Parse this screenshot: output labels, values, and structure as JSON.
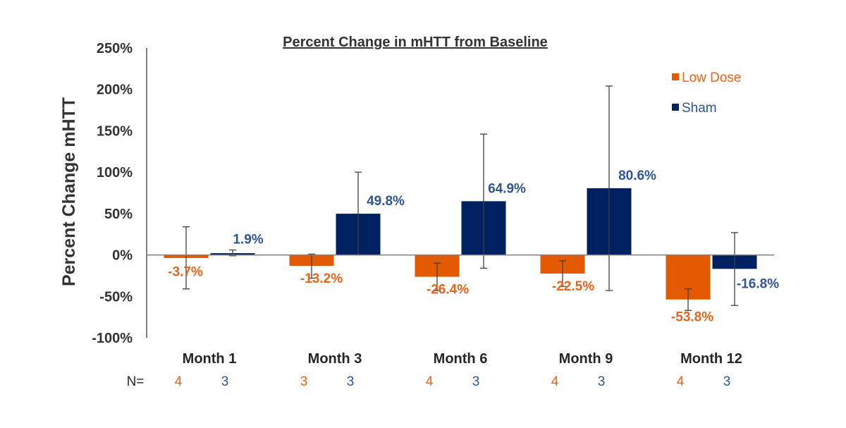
{
  "chart_data": {
    "type": "bar",
    "title": "Percent Change in mHTT from Baseline",
    "xlabel": "",
    "ylabel": "Percent Change mHTT",
    "ylim": [
      -100,
      250
    ],
    "yticks": [
      250,
      200,
      150,
      100,
      50,
      0,
      -50,
      -100
    ],
    "ytick_labels": [
      "250%",
      "200%",
      "150%",
      "100%",
      "50%",
      "0%",
      "-50%",
      "-100%"
    ],
    "grid": false,
    "legend_position": "top-right",
    "categories": [
      "Month 1",
      "Month 3",
      "Month 6",
      "Month 9",
      "Month 12"
    ],
    "series": [
      {
        "name": "Low Dose",
        "color": "#E35A00",
        "label_color": "#E8641A",
        "values": [
          -3.7,
          -13.2,
          -26.4,
          -22.5,
          -53.8
        ],
        "labels": [
          "-3.7%",
          "-13.2%",
          "-26.4%",
          "-22.5%",
          "-53.8%"
        ],
        "error_high": [
          34,
          1,
          -10,
          -7,
          -41
        ],
        "error_low": [
          -41,
          -28,
          -43,
          -38,
          -67
        ],
        "n": [
          "4",
          "3",
          "4",
          "4",
          "4"
        ]
      },
      {
        "name": "Sham",
        "color": "#002060",
        "label_color": "#2F5597",
        "values": [
          1.9,
          49.8,
          64.9,
          80.6,
          -16.8
        ],
        "labels": [
          "1.9%",
          "49.8%",
          "64.9%",
          "80.6%",
          "-16.8%"
        ],
        "error_high": [
          6,
          100,
          146,
          204,
          27
        ],
        "error_low": [
          -1,
          0,
          -16,
          -43,
          -61
        ],
        "n": [
          "3",
          "3",
          "3",
          "3",
          "3"
        ]
      }
    ],
    "n_prefix": "N="
  }
}
